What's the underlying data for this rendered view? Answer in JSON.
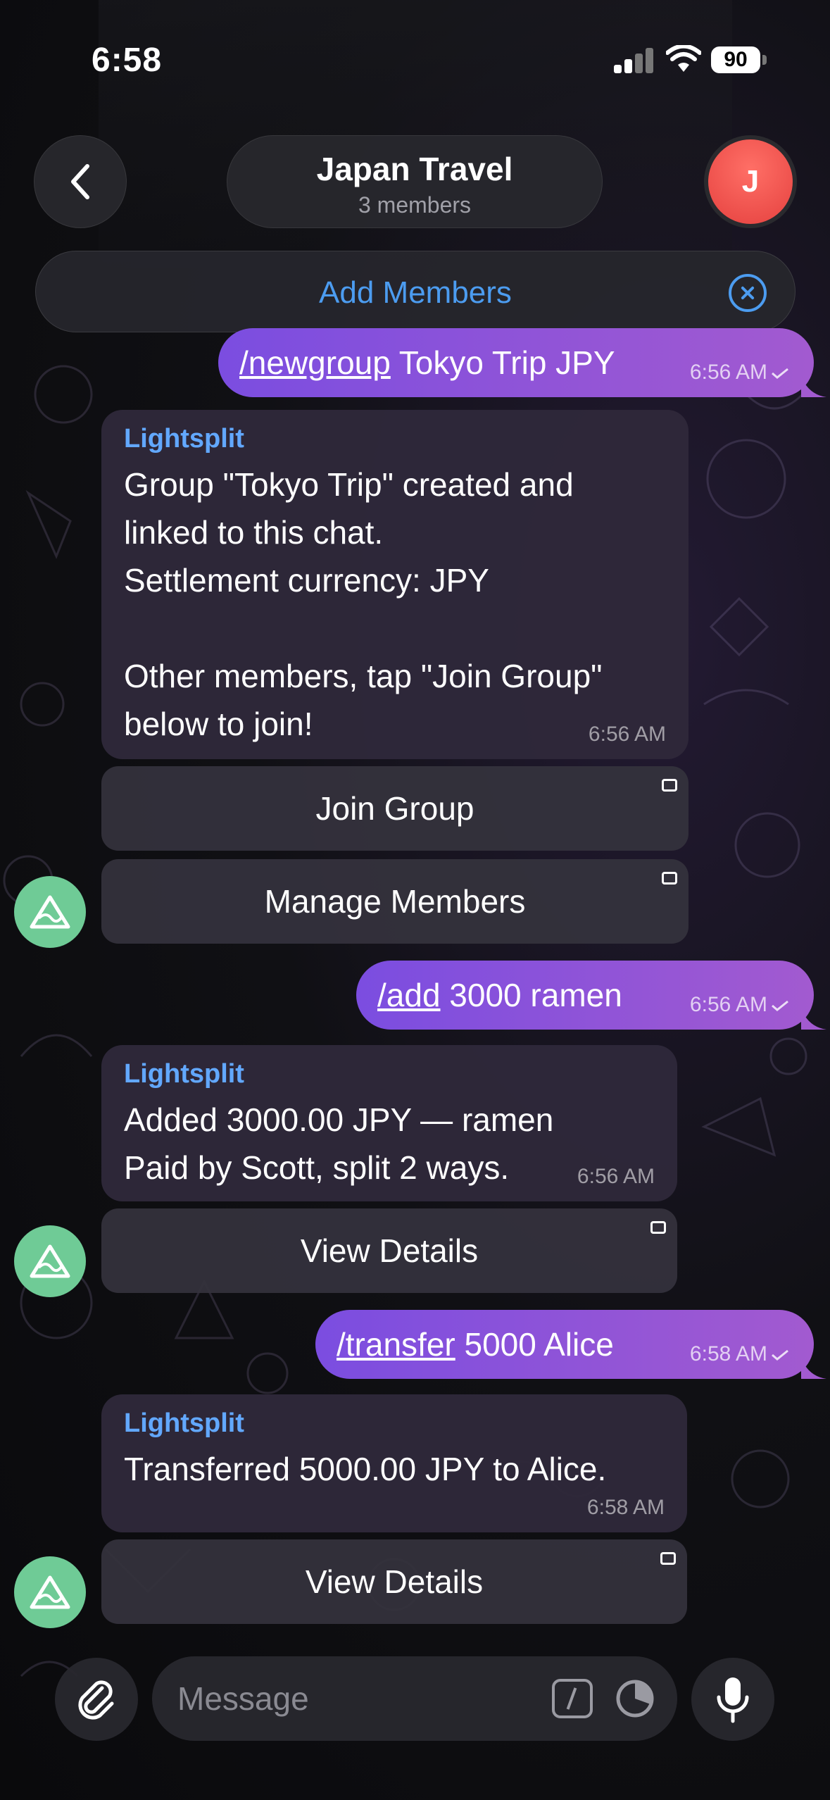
{
  "status_bar": {
    "time": "6:58",
    "battery": "90"
  },
  "header": {
    "title": "Japan Travel",
    "subtitle": "3 members",
    "avatar_initial": "J"
  },
  "banner": {
    "label": "Add Members"
  },
  "messages": [
    {
      "type": "outgoing",
      "command": "/newgroup",
      "text": " Tokyo Trip JPY",
      "time": "6:56 AM"
    },
    {
      "type": "incoming",
      "sender": "Lightsplit",
      "lines": [
        "Group \"Tokyo Trip\" created and",
        "linked to this chat.",
        "Settlement currency: JPY",
        "",
        "Other members, tap \"Join Group\"",
        "below to join!"
      ],
      "time": "6:56 AM",
      "buttons": [
        "Join Group",
        "Manage Members"
      ]
    },
    {
      "type": "outgoing",
      "command": "/add",
      "text": " 3000 ramen",
      "time": "6:56 AM"
    },
    {
      "type": "incoming",
      "sender": "Lightsplit",
      "lines": [
        "Added 3000.00 JPY — ramen",
        "Paid by Scott, split 2 ways."
      ],
      "time": "6:56 AM",
      "buttons": [
        "View Details"
      ]
    },
    {
      "type": "outgoing",
      "command": "/transfer",
      "text": " 5000 Alice",
      "time": "6:58 AM"
    },
    {
      "type": "incoming",
      "sender": "Lightsplit",
      "lines": [
        "Transferred 5000.00 JPY to Alice."
      ],
      "time": "6:58 AM",
      "buttons": [
        "View Details"
      ]
    }
  ],
  "composer": {
    "placeholder": "Message"
  },
  "icons": {
    "back": "chevron-left-icon",
    "close": "close-circle-icon",
    "bot_avatar": "mountain-logo-icon",
    "attach": "paperclip-icon",
    "commands": "slash-command-icon",
    "schedule": "clock-icon",
    "mic": "microphone-icon"
  },
  "colors": {
    "accent": "#4c9cf0",
    "outgoing_start": "#7b4de0",
    "outgoing_end": "#a25ad0",
    "sender": "#62a8ff",
    "bot_avatar": "#6fcb96",
    "avatar_j": "#e5413f"
  }
}
